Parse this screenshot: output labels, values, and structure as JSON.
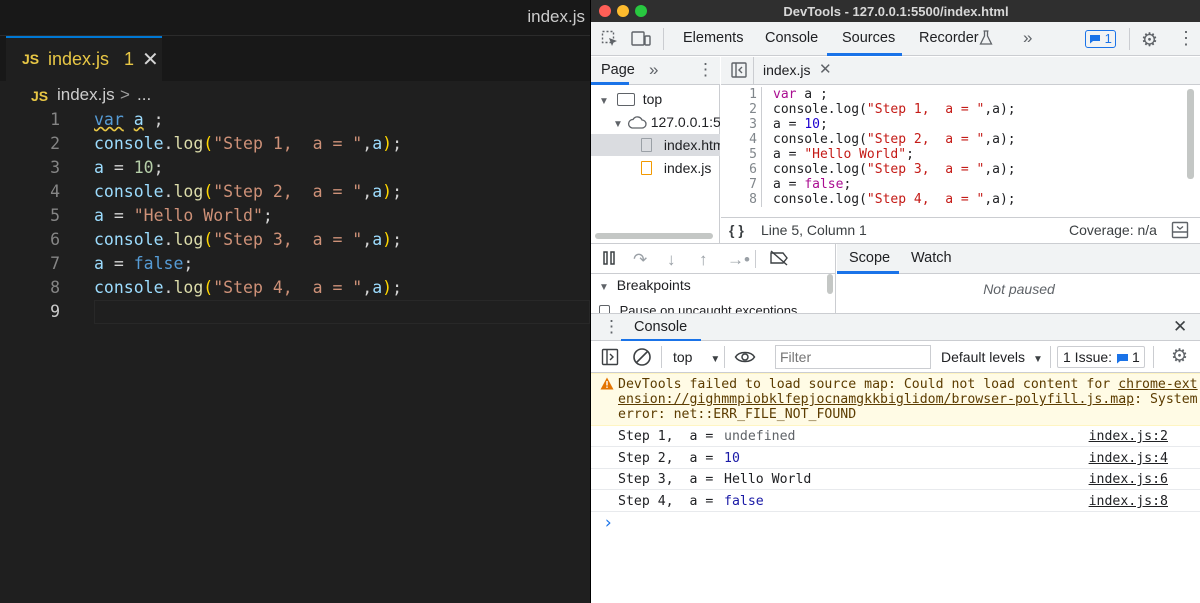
{
  "vscode": {
    "window_title": "index.js",
    "tab": {
      "icon": "JS",
      "name": "index.js",
      "problem_count": "1",
      "close": "✕"
    },
    "breadcrumb": {
      "icon": "JS",
      "file": "index.js",
      "sep": ">",
      "more": "..."
    },
    "line_numbers": [
      "1",
      "2",
      "3",
      "4",
      "5",
      "6",
      "7",
      "8",
      "9"
    ]
  },
  "devtools": {
    "window_title": "DevTools - 127.0.0.1:5500/index.html",
    "traffic_colors": [
      "#ff5f57",
      "#febc2e",
      "#28c840"
    ],
    "tabs": [
      "Elements",
      "Console",
      "Sources",
      "Recorder",
      "»"
    ],
    "active_tab": "Sources",
    "issues_badge": "1",
    "navigator": {
      "tab": "Page",
      "more": "»",
      "tree": [
        "top",
        "127.0.0.1:5",
        "index.htm",
        "index.js"
      ]
    },
    "source": {
      "tab": "index.js",
      "line_numbers": [
        "1",
        "2",
        "3",
        "4",
        "5",
        "6",
        "7",
        "8"
      ],
      "status_position": "Line 5, Column 1",
      "status_coverage": "Coverage: n/a",
      "format_icon": "{ }"
    },
    "debugger": {
      "breakpoints_label": "Breakpoints",
      "pause_exceptions_label": "Pause on uncaught exceptions",
      "scope_tab": "Scope",
      "watch_tab": "Watch",
      "not_paused": "Not paused"
    },
    "console": {
      "drawer_title": "Console",
      "context": "top",
      "filter_placeholder": "Filter",
      "levels": "Default levels",
      "issues_label": "1 Issue:",
      "issues_count": "1",
      "warning": {
        "line1": "DevTools failed to load source map: Could not load content for ",
        "link1": "chrome-ext",
        "link2": "ension://gighmmpiobklfepjocnamgkkbiglidom/browser-polyfill.js.map",
        "line2_tail": ": System",
        "line3": "error: net::ERR_FILE_NOT_FOUND"
      },
      "messages": [
        {
          "label": "Step 1,  a = ",
          "value": "undefined",
          "value_color": "#5f6368",
          "source": "index.js:2"
        },
        {
          "label": "Step 2,  a = ",
          "value": "10",
          "value_color": "#1a1aa6",
          "source": "index.js:4"
        },
        {
          "label": "Step 3,  a = ",
          "value": "Hello World",
          "value_color": "#202124",
          "source": "index.js:6"
        },
        {
          "label": "Step 4,  a = ",
          "value": "false",
          "value_color": "#1a1aa6",
          "source": "index.js:8"
        }
      ],
      "prompt": "›"
    }
  }
}
